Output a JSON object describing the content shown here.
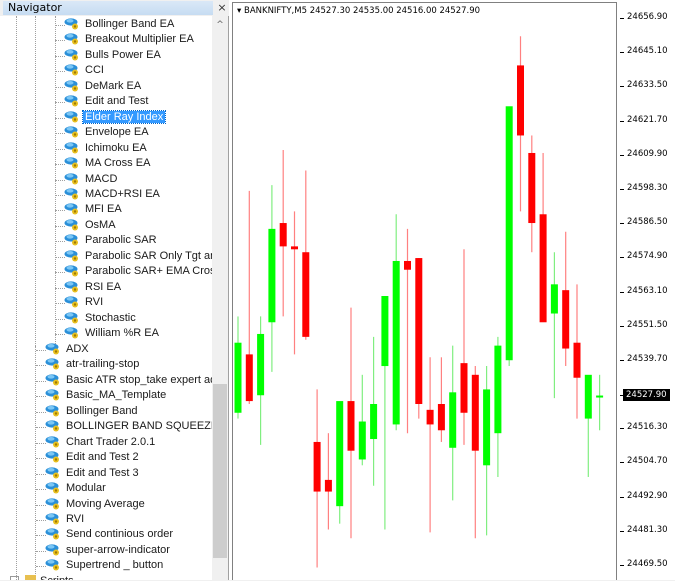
{
  "navigator": {
    "title": "Navigator",
    "close_icon": "×",
    "scroll_up_icon": "^",
    "nested_items": [
      {
        "label": "Bollinger Band EA"
      },
      {
        "label": "Breakout Multiplier EA"
      },
      {
        "label": "Bulls Power EA"
      },
      {
        "label": "CCI"
      },
      {
        "label": "DeMark EA"
      },
      {
        "label": "Edit and Test"
      },
      {
        "label": "Elder Ray Index",
        "selected": true
      },
      {
        "label": "Envelope EA"
      },
      {
        "label": "Ichimoku EA"
      },
      {
        "label": "MA Cross EA"
      },
      {
        "label": "MACD"
      },
      {
        "label": "MACD+RSI EA"
      },
      {
        "label": "MFI EA"
      },
      {
        "label": "OsMA"
      },
      {
        "label": "Parabolic SAR"
      },
      {
        "label": "Parabolic SAR Only Tgt and"
      },
      {
        "label": "Parabolic SAR+ EMA Cross"
      },
      {
        "label": "RSI EA"
      },
      {
        "label": "RVI"
      },
      {
        "label": "Stochastic"
      },
      {
        "label": "William %R EA"
      }
    ],
    "items": [
      {
        "label": "ADX"
      },
      {
        "label": "atr-trailing-stop"
      },
      {
        "label": "Basic ATR stop_take expert advi"
      },
      {
        "label": "Basic_MA_Template"
      },
      {
        "label": "Bollinger Band"
      },
      {
        "label": "BOLLINGER BAND SQUEEZE"
      },
      {
        "label": "Chart Trader 2.0.1"
      },
      {
        "label": "Edit and Test 2"
      },
      {
        "label": "Edit and Test 3"
      },
      {
        "label": "Modular"
      },
      {
        "label": "Moving Average"
      },
      {
        "label": "RVI"
      },
      {
        "label": "Send continious order"
      },
      {
        "label": "super-arrow-indicator"
      },
      {
        "label": "Supertrend _ button"
      }
    ],
    "bottom_item": {
      "label": "Scripts"
    }
  },
  "chart": {
    "symbol_line": "BANKNIFTY,M5  24527.30 24535.00 24516.00 24527.90",
    "dropdown_icon": "▾",
    "current_price": "24527.90",
    "colors": {
      "bull": "#00ff00",
      "bear": "#ff0000",
      "bull_wick": "#80ee80",
      "bear_wick": "#ff8080"
    }
  },
  "chart_data": {
    "type": "candlestick",
    "title": "BANKNIFTY,M5",
    "ohlc_readout": {
      "open": 24527.3,
      "high": 24535.0,
      "low": 24516.0,
      "close": 24527.9
    },
    "y_tick_labels": [
      "24656.90",
      "24645.10",
      "24633.50",
      "24621.70",
      "24609.90",
      "24598.30",
      "24586.50",
      "24574.90",
      "24563.10",
      "24551.50",
      "24539.70",
      "24527.90",
      "24516.30",
      "24504.70",
      "24492.90",
      "24481.30",
      "24469.50"
    ],
    "y_ticks": [
      24656.9,
      24645.1,
      24633.5,
      24621.7,
      24609.9,
      24598.3,
      24586.5,
      24574.9,
      24563.1,
      24551.5,
      24539.7,
      24527.9,
      24516.3,
      24504.7,
      24492.9,
      24481.3,
      24469.5
    ],
    "ylim": [
      24464.0,
      24663.0
    ],
    "candles": [
      {
        "o": 24522.0,
        "h": 24555.0,
        "l": 24520.0,
        "c": 24546.0
      },
      {
        "o": 24542.0,
        "h": 24598.0,
        "l": 24525.0,
        "c": 24526.0
      },
      {
        "o": 24528.0,
        "h": 24555.0,
        "l": 24511.0,
        "c": 24549.0
      },
      {
        "o": 24553.0,
        "h": 24600.0,
        "l": 24536.0,
        "c": 24585.0
      },
      {
        "o": 24587.0,
        "h": 24612.0,
        "l": 24555.0,
        "c": 24579.0
      },
      {
        "o": 24579.0,
        "h": 24591.0,
        "l": 24542.0,
        "c": 24578.0
      },
      {
        "o": 24577.0,
        "h": 24605.0,
        "l": 24547.0,
        "c": 24548.0
      },
      {
        "o": 24512.0,
        "h": 24530.0,
        "l": 24469.0,
        "c": 24495.0
      },
      {
        "o": 24499.0,
        "h": 24515.0,
        "l": 24482.0,
        "c": 24495.0
      },
      {
        "o": 24490.0,
        "h": 24522.0,
        "l": 24484.0,
        "c": 24526.0
      },
      {
        "o": 24526.0,
        "h": 24558.0,
        "l": 24479.0,
        "c": 24509.0
      },
      {
        "o": 24506.0,
        "h": 24535.0,
        "l": 24504.0,
        "c": 24519.0
      },
      {
        "o": 24513.0,
        "h": 24548.0,
        "l": 24497.0,
        "c": 24525.0
      },
      {
        "o": 24538.0,
        "h": 24548.0,
        "l": 24482.0,
        "c": 24562.0
      },
      {
        "o": 24518.0,
        "h": 24590.0,
        "l": 24516.0,
        "c": 24574.0
      },
      {
        "o": 24574.0,
        "h": 24585.0,
        "l": 24515.0,
        "c": 24571.0
      },
      {
        "o": 24575.0,
        "h": 24575.0,
        "l": 24520.0,
        "c": 24525.0
      },
      {
        "o": 24523.0,
        "h": 24541.0,
        "l": 24481.0,
        "c": 24518.0
      },
      {
        "o": 24525.0,
        "h": 24541.0,
        "l": 24512.0,
        "c": 24516.0
      },
      {
        "o": 24510.0,
        "h": 24545.0,
        "l": 24492.0,
        "c": 24529.0
      },
      {
        "o": 24539.0,
        "h": 24578.0,
        "l": 24511.0,
        "c": 24522.0
      },
      {
        "o": 24535.0,
        "h": 24538.0,
        "l": 24479.0,
        "c": 24509.0
      },
      {
        "o": 24504.0,
        "h": 24538.0,
        "l": 24480.0,
        "c": 24530.0
      },
      {
        "o": 24515.0,
        "h": 24548.0,
        "l": 24500.0,
        "c": 24545.0
      },
      {
        "o": 24540.0,
        "h": 24597.0,
        "l": 24538.0,
        "c": 24627.0
      },
      {
        "o": 24641.0,
        "h": 24651.0,
        "l": 24591.0,
        "c": 24617.0
      },
      {
        "o": 24611.0,
        "h": 24617.0,
        "l": 24577.0,
        "c": 24587.0
      },
      {
        "o": 24590.0,
        "h": 24611.0,
        "l": 24575.0,
        "c": 24553.0
      },
      {
        "o": 24556.0,
        "h": 24577.0,
        "l": 24527.0,
        "c": 24566.0
      },
      {
        "o": 24564.0,
        "h": 24584.0,
        "l": 24538.0,
        "c": 24544.0
      },
      {
        "o": 24546.0,
        "h": 24566.0,
        "l": 24520.0,
        "c": 24534.0
      },
      {
        "o": 24520.0,
        "h": 24532.0,
        "l": 24500.0,
        "c": 24535.0
      },
      {
        "o": 24527.3,
        "h": 24535.0,
        "l": 24516.0,
        "c": 24527.9
      }
    ]
  }
}
